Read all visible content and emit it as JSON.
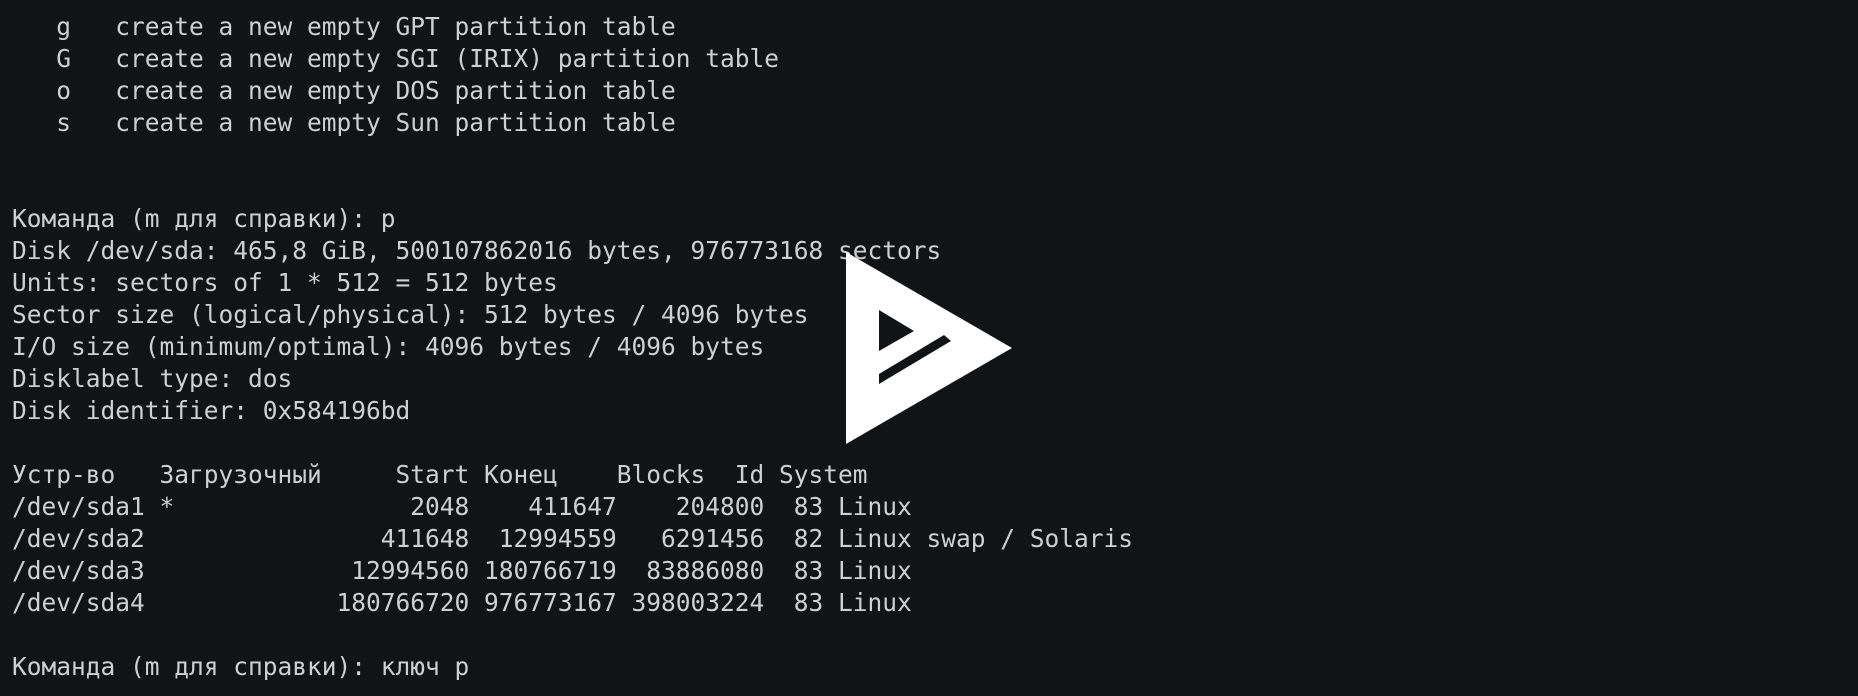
{
  "terminal": {
    "lines": [
      "   g   create a new empty GPT partition table",
      "   G   create a new empty SGI (IRIX) partition table",
      "   o   create a new empty DOS partition table",
      "   s   create a new empty Sun partition table",
      "",
      "",
      "Команда (m для справки): p",
      "Disk /dev/sda: 465,8 GiB, 500107862016 bytes, 976773168 sectors",
      "Units: sectors of 1 * 512 = 512 bytes",
      "Sector size (logical/physical): 512 bytes / 4096 bytes",
      "I/O size (minimum/optimal): 4096 bytes / 4096 bytes",
      "Disklabel type: dos",
      "Disk identifier: 0x584196bd",
      "",
      "Устр-во   Загрузочный     Start Конец    Blocks  Id System",
      "/dev/sda1 *                2048    411647    204800  83 Linux",
      "/dev/sda2                411648  12994559   6291456  82 Linux swap / Solaris",
      "/dev/sda3              12994560 180766719  83886080  83 Linux",
      "/dev/sda4             180766720 976773167 398003224  83 Linux",
      "",
      "Команда (m для справки): ключ p"
    ]
  },
  "overlay": {
    "icon": "asciinema-play-icon",
    "color": "#ffffff"
  },
  "colors": {
    "background": "#121314",
    "text": "#cfcfcf"
  }
}
